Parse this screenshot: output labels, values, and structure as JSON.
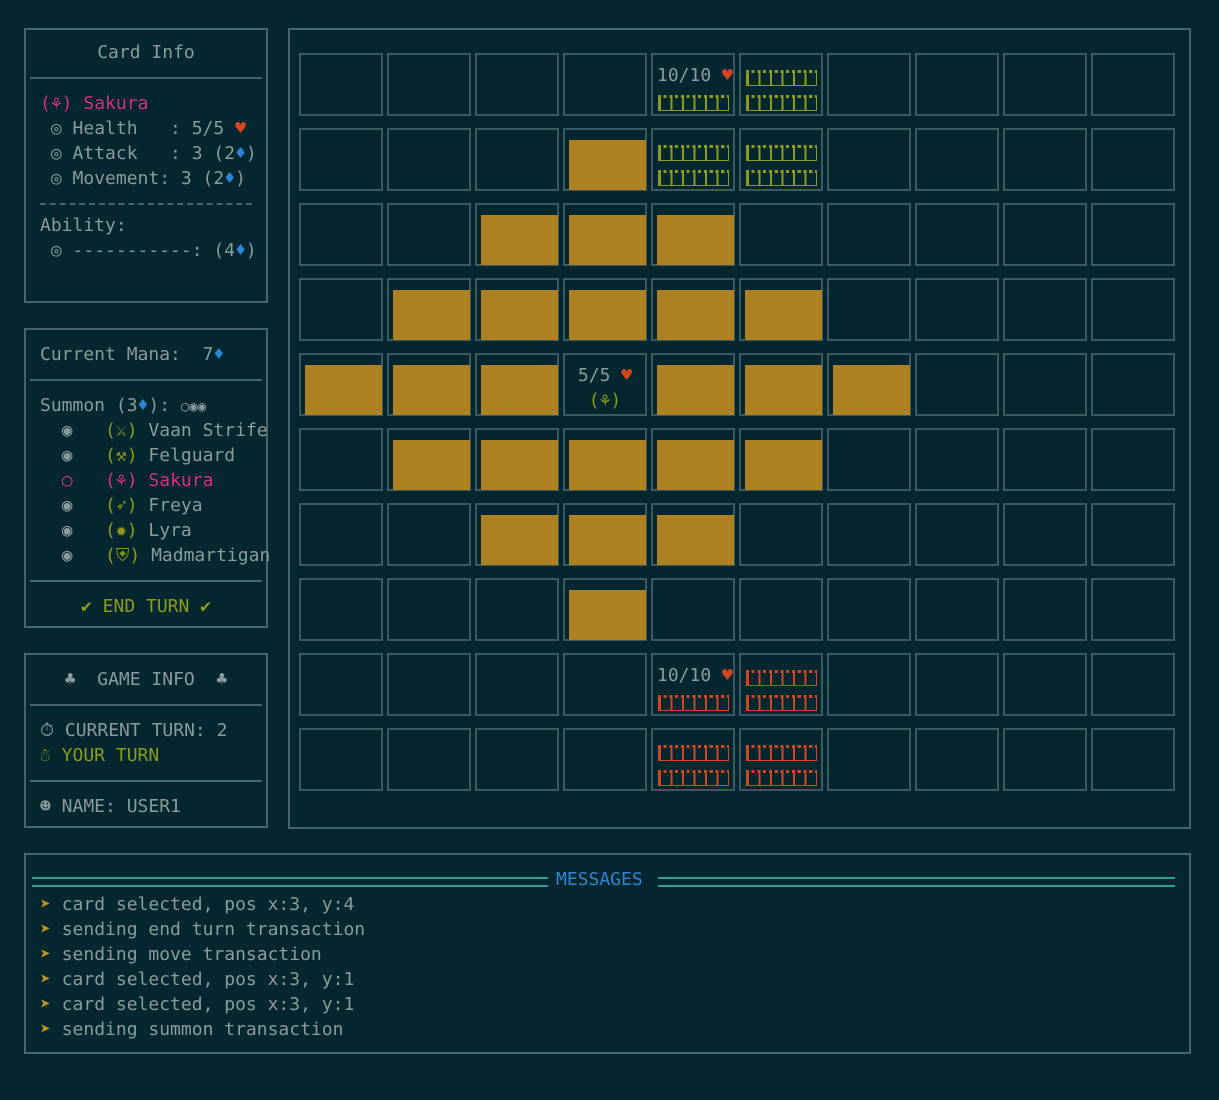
{
  "card_info": {
    "title": "Card Info",
    "icon": "(⚘)",
    "name": "Sakura",
    "health_label": "◎ Health   : ",
    "health": "5/5",
    "attack_label": "◎ Attack   : 3 (2",
    "movement_label": "◎ Movement: 3 (2",
    "ability_title": "Ability:",
    "ability_label": "◎ -----------: (4",
    "close": ")",
    "heart": "♥",
    "mana": "♦"
  },
  "mana_panel": {
    "label": "Current Mana:  7",
    "summon_label": "Summon (3",
    "summon_tail": "): ",
    "summon_pips": "○◉◉",
    "cards": [
      {
        "bullet": "◉",
        "icon": "(⚔)",
        "name": "Vaan Strife",
        "selected": false
      },
      {
        "bullet": "◉",
        "icon": "(⚒)",
        "name": "Felguard",
        "selected": false
      },
      {
        "bullet": "○",
        "icon": "(⚘)",
        "name": "Sakura",
        "selected": true
      },
      {
        "bullet": "◉",
        "icon": "(➶)",
        "name": "Freya",
        "selected": false
      },
      {
        "bullet": "◉",
        "icon": "(✹)",
        "name": "Lyra",
        "selected": false
      },
      {
        "bullet": "◉",
        "icon": "(⛨)",
        "name": "Madmartigan",
        "selected": false
      }
    ],
    "end_turn": "✔ END TURN ✔"
  },
  "game_info": {
    "title": "♣  GAME INFO  ♣",
    "turn": "⏱ CURRENT TURN: 2",
    "your_turn": "☃ YOUR TURN",
    "name": "☻ NAME: USER1"
  },
  "board": {
    "base_hp_ally": "10/10",
    "base_hp_enemy": "10/10",
    "unit_hp": "5/5",
    "unit_icon": "(⚘)",
    "rows": [
      [
        "",
        "",
        "",
        "",
        "ally-base-hp",
        "ally-base",
        "",
        "",
        "",
        ""
      ],
      [
        "",
        "",
        "",
        "move",
        "ally-base",
        "ally-base",
        "",
        "",
        "",
        ""
      ],
      [
        "",
        "",
        "move",
        "move",
        "move",
        "",
        "",
        "",
        "",
        ""
      ],
      [
        "",
        "move",
        "move",
        "move",
        "move",
        "move",
        "",
        "",
        "",
        ""
      ],
      [
        "move",
        "move",
        "move",
        "unit",
        "move",
        "move",
        "move",
        "",
        "",
        ""
      ],
      [
        "",
        "move",
        "move",
        "move",
        "move",
        "move",
        "",
        "",
        "",
        ""
      ],
      [
        "",
        "",
        "move",
        "move",
        "move",
        "",
        "",
        "",
        "",
        ""
      ],
      [
        "",
        "",
        "",
        "move",
        "",
        "",
        "",
        "",
        "",
        ""
      ],
      [
        "",
        "",
        "",
        "",
        "enemy-base-hp",
        "enemy-base",
        "",
        "",
        "",
        ""
      ],
      [
        "",
        "",
        "",
        "",
        "enemy-base",
        "enemy-base",
        "",
        "",
        "",
        ""
      ]
    ]
  },
  "messages": {
    "title": "MESSAGES",
    "bullet": "➤",
    "items": [
      "card selected, pos x:3, y:4",
      "sending end turn transaction",
      "sending move transaction",
      "card selected, pos x:3, y:1",
      "card selected, pos x:3, y:1",
      "sending summon transaction"
    ]
  },
  "colors": {
    "bg": "#04262f",
    "move": "#ad8122",
    "ally": "#8d9a1a",
    "enemy": "#d2451f",
    "accent": "#2d86d4",
    "selected": "#d6307a"
  }
}
